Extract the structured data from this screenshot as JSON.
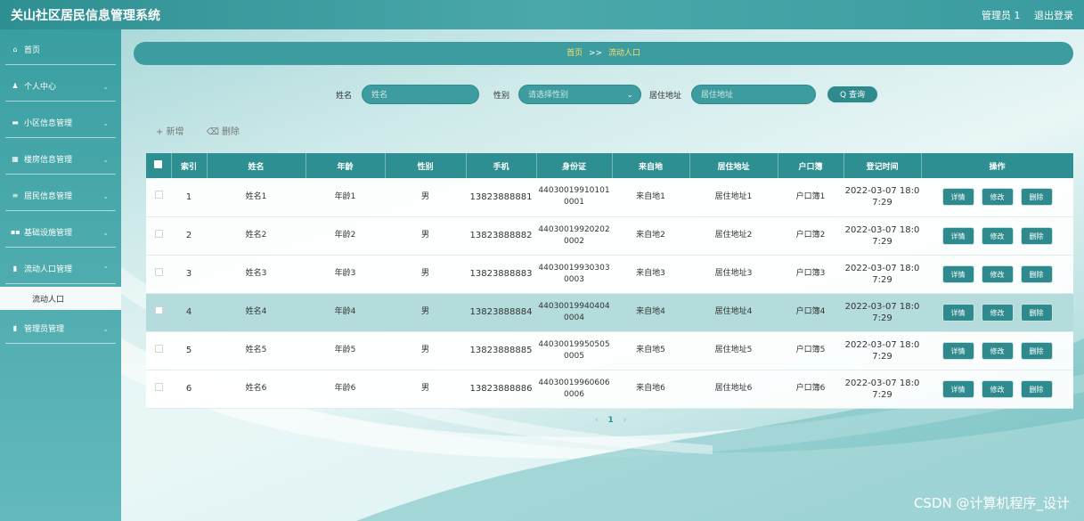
{
  "app": {
    "title": "关山社区居民信息管理系统",
    "user": "管理员 1",
    "logout": "退出登录"
  },
  "sidebar": {
    "items": [
      {
        "icon": "⌂",
        "label": "首页"
      },
      {
        "icon": "♟",
        "label": "个人中心"
      },
      {
        "icon": "▬",
        "label": "小区信息管理"
      },
      {
        "icon": "▦",
        "label": "楼房信息管理"
      },
      {
        "icon": "≡",
        "label": "居民信息管理"
      },
      {
        "icon": "▪▪",
        "label": "基础设施管理"
      },
      {
        "icon": "▮",
        "label": "流动人口管理"
      },
      {
        "icon": "▮",
        "label": "管理员管理"
      }
    ],
    "subitem": "流动人口"
  },
  "breadcrumb": {
    "home": "首页",
    "sep": ">>",
    "current": "流动人口"
  },
  "search": {
    "name_label": "姓名",
    "name_placeholder": "姓名",
    "gender_label": "性别",
    "gender_placeholder": "请选择性别",
    "address_label": "居住地址",
    "address_placeholder": "居住地址",
    "query_label": "Q 查询"
  },
  "actions": {
    "add": "+ 新增",
    "delete": "删除"
  },
  "table": {
    "headers": [
      "索引",
      "姓名",
      "年龄",
      "性别",
      "手机",
      "身份证",
      "来自地",
      "居住地址",
      "户口簿",
      "登记时间",
      "操作"
    ],
    "rows": [
      [
        "1",
        "姓名1",
        "年龄1",
        "男",
        "13823888881",
        "44030019910101\n0001",
        "来自地1",
        "居住地址1",
        "户口簿1",
        "2022-03-07 18:0\n7:29"
      ],
      [
        "2",
        "姓名2",
        "年龄2",
        "男",
        "13823888882",
        "44030019920202\n0002",
        "来自地2",
        "居住地址2",
        "户口簿2",
        "2022-03-07 18:0\n7:29"
      ],
      [
        "3",
        "姓名3",
        "年龄3",
        "男",
        "13823888883",
        "44030019930303\n0003",
        "来自地3",
        "居住地址3",
        "户口簿3",
        "2022-03-07 18:0\n7:29"
      ],
      [
        "4",
        "姓名4",
        "年龄4",
        "男",
        "13823888884",
        "44030019940404\n0004",
        "来自地4",
        "居住地址4",
        "户口簿4",
        "2022-03-07 18:0\n7:29"
      ],
      [
        "5",
        "姓名5",
        "年龄5",
        "男",
        "13823888885",
        "44030019950505\n0005",
        "来自地5",
        "居住地址5",
        "户口簿5",
        "2022-03-07 18:0\n7:29"
      ],
      [
        "6",
        "姓名6",
        "年龄6",
        "男",
        "13823888886",
        "44030019960606\n0006",
        "来自地6",
        "居住地址6",
        "户口簿6",
        "2022-03-07 18:0\n7:29"
      ]
    ],
    "ops": {
      "detail": "详情",
      "edit": "修改",
      "delete": "删除"
    }
  },
  "pager": {
    "prev": "‹",
    "current": "1",
    "next": "›"
  },
  "watermark": "CSDN @计算机程序_设计",
  "colors": {
    "primary": "#2e8f92",
    "accent": "#f5e16a"
  }
}
